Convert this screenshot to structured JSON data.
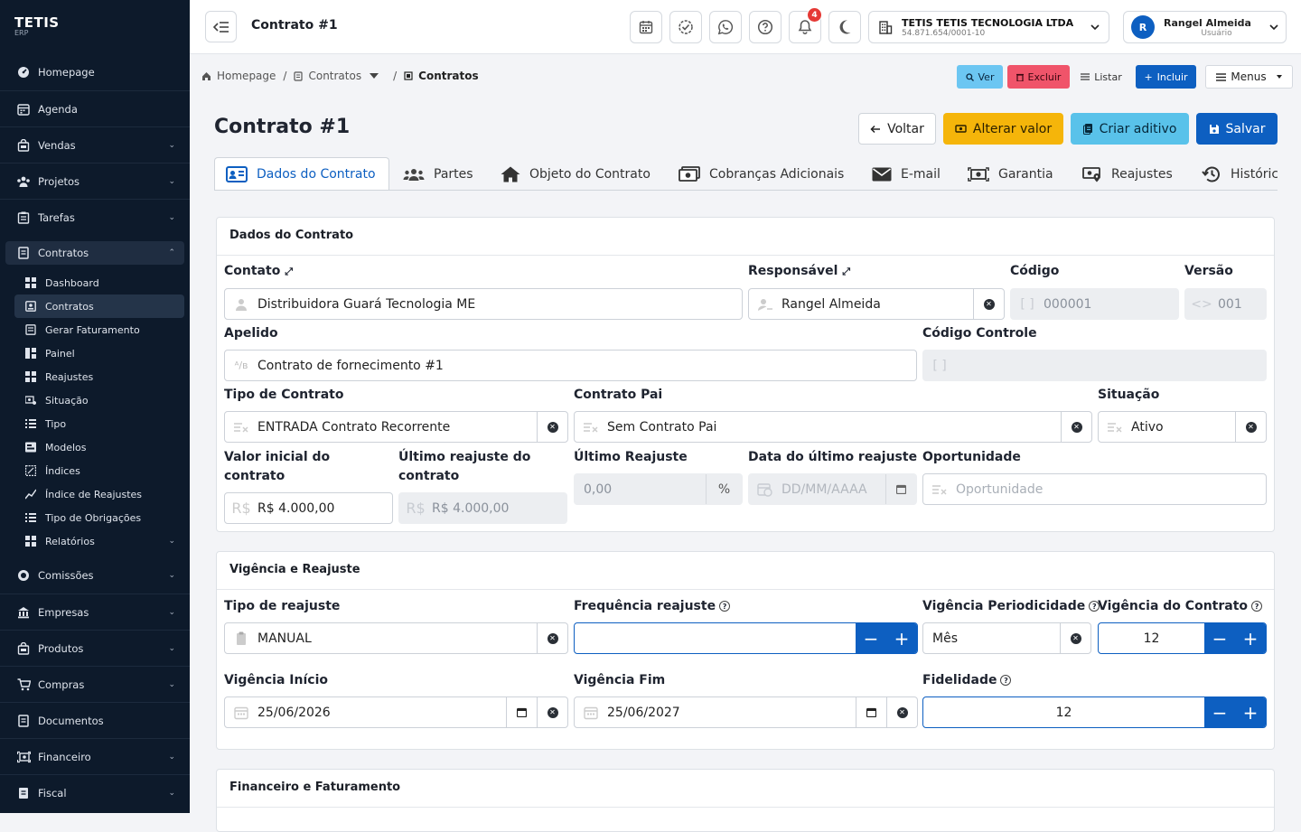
{
  "brand": {
    "name": "TETIS",
    "sub": "ERP"
  },
  "sidebar": {
    "items": [
      {
        "label": "Homepage",
        "icon": "dashboard-icon",
        "chev": ""
      },
      {
        "label": "Agenda",
        "icon": "calendar-icon",
        "chev": ""
      },
      {
        "label": "Vendas",
        "icon": "shopping-bag-icon",
        "chev": "⌄"
      },
      {
        "label": "Projetos",
        "icon": "projects-icon",
        "chev": "⌄"
      },
      {
        "label": "Tarefas",
        "icon": "tasks-icon",
        "chev": "⌄"
      }
    ],
    "active": {
      "label": "Contratos",
      "icon": "contract-icon",
      "chev": "⌃"
    },
    "sub": [
      {
        "label": "Dashboard",
        "chev": ""
      },
      {
        "label": "Contratos",
        "chev": ""
      },
      {
        "label": "Gerar Faturamento",
        "chev": ""
      },
      {
        "label": "Painel",
        "chev": ""
      },
      {
        "label": "Reajustes",
        "chev": ""
      },
      {
        "label": "Situação",
        "chev": ""
      },
      {
        "label": "Tipo",
        "chev": ""
      },
      {
        "label": "Modelos",
        "chev": ""
      },
      {
        "label": "Índices",
        "chev": ""
      },
      {
        "label": "Índice de Reajustes",
        "chev": ""
      },
      {
        "label": "Tipo de Obrigações",
        "chev": ""
      },
      {
        "label": "Relatórios",
        "chev": "⌄"
      }
    ],
    "bottom": [
      {
        "label": "Comissões",
        "icon": "coins-icon",
        "chev": "⌄"
      },
      {
        "label": "Empresas",
        "icon": "building-icon",
        "chev": "⌄"
      },
      {
        "label": "Produtos",
        "icon": "box-icon",
        "chev": "⌄"
      },
      {
        "label": "Compras",
        "icon": "cart-icon",
        "chev": "⌄"
      },
      {
        "label": "Documentos",
        "icon": "document-icon",
        "chev": ""
      },
      {
        "label": "Financeiro",
        "icon": "money-icon",
        "chev": "⌄"
      },
      {
        "label": "Fiscal",
        "icon": "fiscal-icon",
        "chev": "⌄"
      }
    ]
  },
  "topbar": {
    "title": "Contrato #1",
    "notifications": "4",
    "company": {
      "name": "TETIS TETIS TECNOLOGIA LTDA",
      "cnpj": "54.871.654/0001-10"
    },
    "user": {
      "initial": "R",
      "name": "Rangel Almeida",
      "role": "Usuário"
    }
  },
  "breadcrumb": {
    "home": "Homepage",
    "mid": "Contratos",
    "current": "Contratos",
    "sep": "/"
  },
  "mini_actions": {
    "ver": "Ver",
    "excluir": "Excluir",
    "listar": "Listar",
    "incluir": "Incluir",
    "menus": "Menus"
  },
  "page": {
    "title": "Contrato #1"
  },
  "actions": {
    "voltar": "Voltar",
    "alterar": "Alterar valor",
    "aditivo": "Criar aditivo",
    "salvar": "Salvar"
  },
  "tabs": [
    "Dados do Contrato",
    "Partes",
    "Objeto do Contrato",
    "Cobranças Adicionais",
    "E-mail",
    "Garantia",
    "Reajustes",
    "Histórico"
  ],
  "dados": {
    "heading": "Dados do Contrato",
    "contato": {
      "label": "Contato",
      "value": "Distribuidora Guará Tecnologia ME"
    },
    "responsavel": {
      "label": "Responsável",
      "value": "Rangel Almeida"
    },
    "codigo": {
      "label": "Código",
      "value": "000001"
    },
    "versao": {
      "label": "Versão",
      "value": "001"
    },
    "apelido": {
      "label": "Apelido",
      "value": "Contrato de fornecimento #1"
    },
    "codigo_controle": {
      "label": "Código Controle",
      "value": ""
    },
    "tipo": {
      "label": "Tipo de Contrato",
      "value": "ENTRADA Contrato Recorrente"
    },
    "pai": {
      "label": "Contrato Pai",
      "value": "Sem Contrato Pai"
    },
    "situacao": {
      "label": "Situação",
      "value": "Ativo"
    },
    "valor_inicial": {
      "label1": "Valor inicial do",
      "label2": "contrato",
      "value": "R$ 4.000,00"
    },
    "ultimo_reajuste_valor": {
      "label1": "Último reajuste do",
      "label2": "contrato",
      "value": "R$ 4.000,00"
    },
    "ultimo_reajuste": {
      "label": "Último Reajuste",
      "value": "0,00",
      "unit": "%"
    },
    "data_reajuste": {
      "label": "Data do último reajuste",
      "placeholder": "DD/MM/AAAA"
    },
    "oportunidade": {
      "label": "Oportunidade",
      "placeholder": "Oportunidade"
    }
  },
  "vigencia": {
    "heading": "Vigência e Reajuste",
    "tipo_reajuste": {
      "label": "Tipo de reajuste",
      "value": "MANUAL"
    },
    "frequencia": {
      "label": "Frequência reajuste",
      "value": ""
    },
    "periodicidade": {
      "label": "Vigência Periodicidade",
      "value": "Mês"
    },
    "vig_contrato": {
      "label": "Vigência do Contrato",
      "value": "12"
    },
    "inicio": {
      "label": "Vigência Início",
      "value": "25/06/2026"
    },
    "fim": {
      "label": "Vigência Fim",
      "value": "25/06/2027"
    },
    "fidelidade": {
      "label": "Fidelidade",
      "value": "12"
    }
  },
  "financeiro": {
    "heading": "Financeiro e Faturamento"
  },
  "colors": {
    "sidebar": "#0d1a2b",
    "primary": "#0d5fc1",
    "warning": "#f5b50a",
    "info": "#6cc6f2",
    "danger": "#f0546a",
    "cyan": "#59c2ea"
  }
}
